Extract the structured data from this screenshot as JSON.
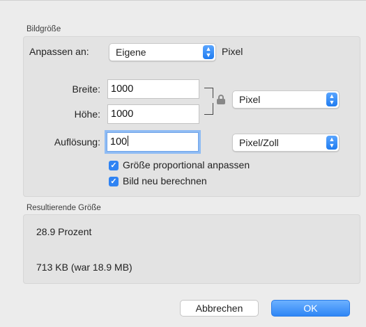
{
  "image_size": {
    "title": "Bildgröße",
    "fit_label": "Anpassen an:",
    "fit_value": "Eigene",
    "fit_unit": "Pixel",
    "width_label": "Breite:",
    "width_value": "1000",
    "height_label": "Höhe:",
    "height_value": "1000",
    "dimension_unit": "Pixel",
    "resolution_label": "Auflösung:",
    "resolution_value": "100",
    "resolution_unit": "Pixel/Zoll",
    "scale_proportionally_label": "Größe proportional anpassen",
    "scale_proportionally_checked": true,
    "resample_label": "Bild neu berechnen",
    "resample_checked": true
  },
  "result": {
    "title": "Resultierende Größe",
    "percent": "28.9 Prozent",
    "size": "713 KB (war 18.9 MB)"
  },
  "buttons": {
    "cancel": "Abbrechen",
    "ok": "OK"
  },
  "icons": {
    "lock": "lock-icon",
    "popup_arrows": "up-down-arrows-icon",
    "checkmark": "checkmark-icon"
  },
  "colors": {
    "accent": "#2f83f3",
    "focus_ring": "#8fbcf4",
    "window_bg": "#ececec",
    "panel_bg": "#e3e3e3"
  }
}
